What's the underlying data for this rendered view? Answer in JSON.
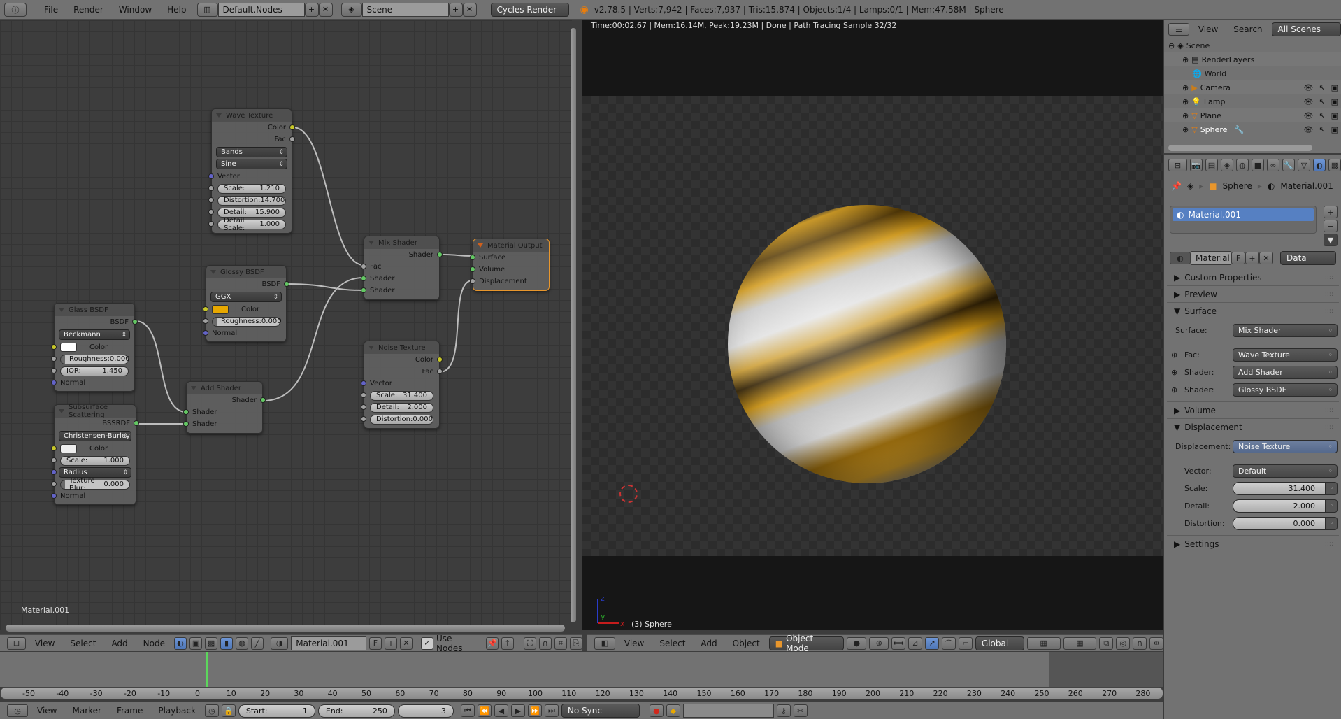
{
  "topbar": {
    "info_icon": "info-icon",
    "menus": [
      "File",
      "Render",
      "Window",
      "Help"
    ],
    "screen_layout": "Default.Nodes",
    "scene": "Scene",
    "engine": "Cycles Render",
    "stats": "v2.78.5 | Verts:7,942 | Faces:7,937 | Tris:15,874 | Objects:1/4 | Lamps:0/1 | Mem:47.58M | Sphere"
  },
  "node_editor": {
    "material_label": "Material.001",
    "nodes": {
      "wave": {
        "title": "Wave Texture",
        "outputs": [
          "Color",
          "Fac"
        ],
        "type_select": "Bands",
        "profile_select": "Sine",
        "vector": "Vector",
        "fields": [
          {
            "label": "Scale:",
            "value": "1.210"
          },
          {
            "label": "Distortion:",
            "value": "14.700"
          },
          {
            "label": "Detail:",
            "value": "15.900"
          },
          {
            "label": "Detail Scale:",
            "value": "1.000"
          }
        ]
      },
      "glossy": {
        "title": "Glossy BSDF",
        "output": "BSDF",
        "dist_select": "GGX",
        "color_label": "Color",
        "color": "#e8a800",
        "roughness_label": "Roughness:",
        "roughness": "0.000",
        "normal": "Normal"
      },
      "glass": {
        "title": "Glass BSDF",
        "output": "BSDF",
        "dist_select": "Beckmann",
        "color_label": "Color",
        "color": "#ffffff",
        "roughness_label": "Roughness:",
        "roughness": "0.000",
        "ior_label": "IOR:",
        "ior": "1.450",
        "normal": "Normal"
      },
      "sss": {
        "title": "Subsurface Scattering",
        "output": "BSSRDF",
        "falloff_select": "Christensen-Burley",
        "color_label": "Color",
        "color": "#eeeeee",
        "scale_label": "Scale:",
        "scale": "1.000",
        "radius_select": "Radius",
        "blur_label": "Texture Blur:",
        "blur": "0.000",
        "normal": "Normal"
      },
      "add": {
        "title": "Add Shader",
        "output": "Shader",
        "inputs": [
          "Shader",
          "Shader"
        ]
      },
      "mix": {
        "title": "Mix Shader",
        "output": "Shader",
        "inputs": [
          "Fac",
          "Shader",
          "Shader"
        ]
      },
      "output": {
        "title": "Material Output",
        "inputs": [
          "Surface",
          "Volume",
          "Displacement"
        ]
      },
      "noise": {
        "title": "Noise Texture",
        "outputs": [
          "Color",
          "Fac"
        ],
        "vector": "Vector",
        "fields": [
          {
            "label": "Scale:",
            "value": "31.400"
          },
          {
            "label": "Detail:",
            "value": "2.000"
          },
          {
            "label": "Distortion:",
            "value": "0.000"
          }
        ]
      }
    },
    "header": {
      "menus": [
        "View",
        "Select",
        "Add",
        "Node"
      ],
      "material": "Material.001",
      "fake_user": "F",
      "use_nodes_label": "Use Nodes",
      "use_nodes": true
    }
  },
  "viewport": {
    "render_status": "Time:00:02.67 | Mem:16.14M, Peak:19.23M | Done | Path Tracing Sample 32/32",
    "object_label": "(3) Sphere",
    "axes": {
      "x": "x",
      "y": "y",
      "z": "z"
    },
    "header": {
      "menus": [
        "View",
        "Select",
        "Add",
        "Object"
      ],
      "mode": "Object Mode",
      "orientation": "Global"
    }
  },
  "outliner": {
    "menus": [
      "View",
      "Search"
    ],
    "filter": "All Scenes",
    "items": [
      {
        "name": "Scene",
        "icon": "scene-icon"
      },
      {
        "name": "RenderLayers",
        "icon": "render-layers-icon"
      },
      {
        "name": "World",
        "icon": "world-icon"
      },
      {
        "name": "Camera",
        "icon": "camera-icon"
      },
      {
        "name": "Lamp",
        "icon": "lamp-icon"
      },
      {
        "name": "Plane",
        "icon": "mesh-icon"
      },
      {
        "name": "Sphere",
        "icon": "mesh-icon"
      }
    ]
  },
  "properties": {
    "breadcrumb": [
      "Sphere",
      "Material.001"
    ],
    "material_slot": "Material.001",
    "material_name": "Material.",
    "fake_user": "F",
    "link": "Data",
    "panels": {
      "custom_properties": "Custom Properties",
      "preview": "Preview",
      "surface": "Surface",
      "volume": "Volume",
      "displacement": "Displacement",
      "settings": "Settings"
    },
    "surface": {
      "surface_label": "Surface:",
      "surface_value": "Mix Shader",
      "fac_label": "Fac:",
      "fac_value": "Wave Texture",
      "shader1_label": "Shader:",
      "shader1_value": "Add Shader",
      "shader2_label": "Shader:",
      "shader2_value": "Glossy BSDF"
    },
    "displacement": {
      "disp_label": "Displacement:",
      "disp_value": "Noise Texture",
      "vector_label": "Vector:",
      "vector_value": "Default",
      "scale_label": "Scale:",
      "scale_value": "31.400",
      "detail_label": "Detail:",
      "detail_value": "2.000",
      "distortion_label": "Distortion:",
      "distortion_value": "0.000"
    }
  },
  "timeline": {
    "ticks": [
      "-50",
      "-40",
      "-30",
      "-20",
      "-10",
      "0",
      "10",
      "20",
      "30",
      "40",
      "50",
      "60",
      "70",
      "80",
      "90",
      "100",
      "110",
      "120",
      "130",
      "140",
      "150",
      "160",
      "170",
      "180",
      "190",
      "200",
      "210",
      "220",
      "230",
      "240",
      "250",
      "260",
      "270",
      "280"
    ],
    "menus": [
      "View",
      "Marker",
      "Frame",
      "Playback"
    ],
    "start_label": "Start:",
    "start": "1",
    "end_label": "End:",
    "end": "250",
    "current_frame": "3",
    "sync": "No Sync"
  }
}
